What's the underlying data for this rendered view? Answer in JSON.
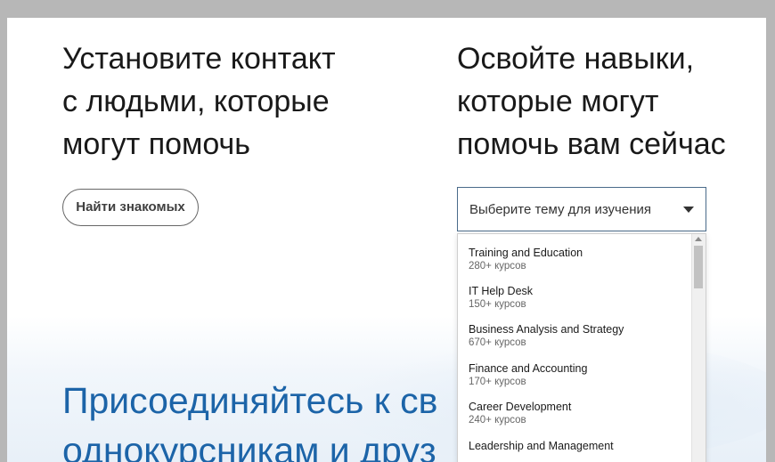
{
  "left_section": {
    "heading": "Установите контакт\nс людьми, которые\nмогут помочь",
    "button_label": "Найти знакомых"
  },
  "right_section": {
    "heading": "Освойте навыки,\nкоторые могут\nпомочь вам сейчас",
    "select_placeholder": "Выберите тему для изучения"
  },
  "dropdown": {
    "items": [
      {
        "title": "Training and Education",
        "count": "280+ курсов"
      },
      {
        "title": "IT Help Desk",
        "count": "150+ курсов"
      },
      {
        "title": "Business Analysis and Strategy",
        "count": "670+ курсов"
      },
      {
        "title": "Finance and Accounting",
        "count": "170+ курсов"
      },
      {
        "title": "Career Development",
        "count": "240+ курсов"
      },
      {
        "title": "Leadership and Management",
        "count": ""
      }
    ]
  },
  "join_section": {
    "line1_left": "Присоединяйтесь к св",
    "line1_right": ",",
    "line2_left": "однокурсникам и друз",
    "line2_right": "."
  },
  "colors": {
    "heading": "#191919",
    "accent": "#1c64a8",
    "select_border": "#4a6b8a"
  }
}
